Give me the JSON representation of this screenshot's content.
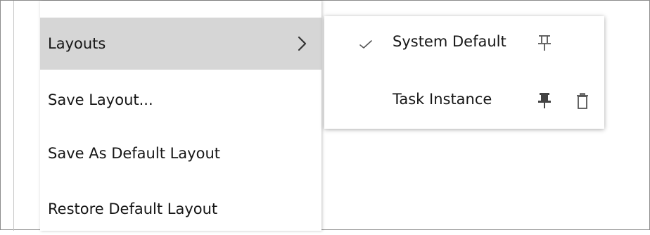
{
  "context_menu": {
    "items": [
      {
        "label": "Layouts",
        "has_submenu": true,
        "selected": true
      },
      {
        "label": "Save Layout..."
      },
      {
        "label": "Save As Default Layout"
      },
      {
        "label": "Restore Default Layout"
      }
    ]
  },
  "layouts_submenu": {
    "items": [
      {
        "label": "System Default",
        "checked": true,
        "pinned": false,
        "actions": [
          "pin-outline-icon"
        ]
      },
      {
        "label": "Task Instance",
        "checked": false,
        "pinned": true,
        "actions": [
          "pin-filled-icon",
          "trash-icon"
        ]
      }
    ]
  },
  "colors": {
    "selected_background": "#d6d6d6",
    "text": "#161616",
    "icon": "#555555"
  }
}
